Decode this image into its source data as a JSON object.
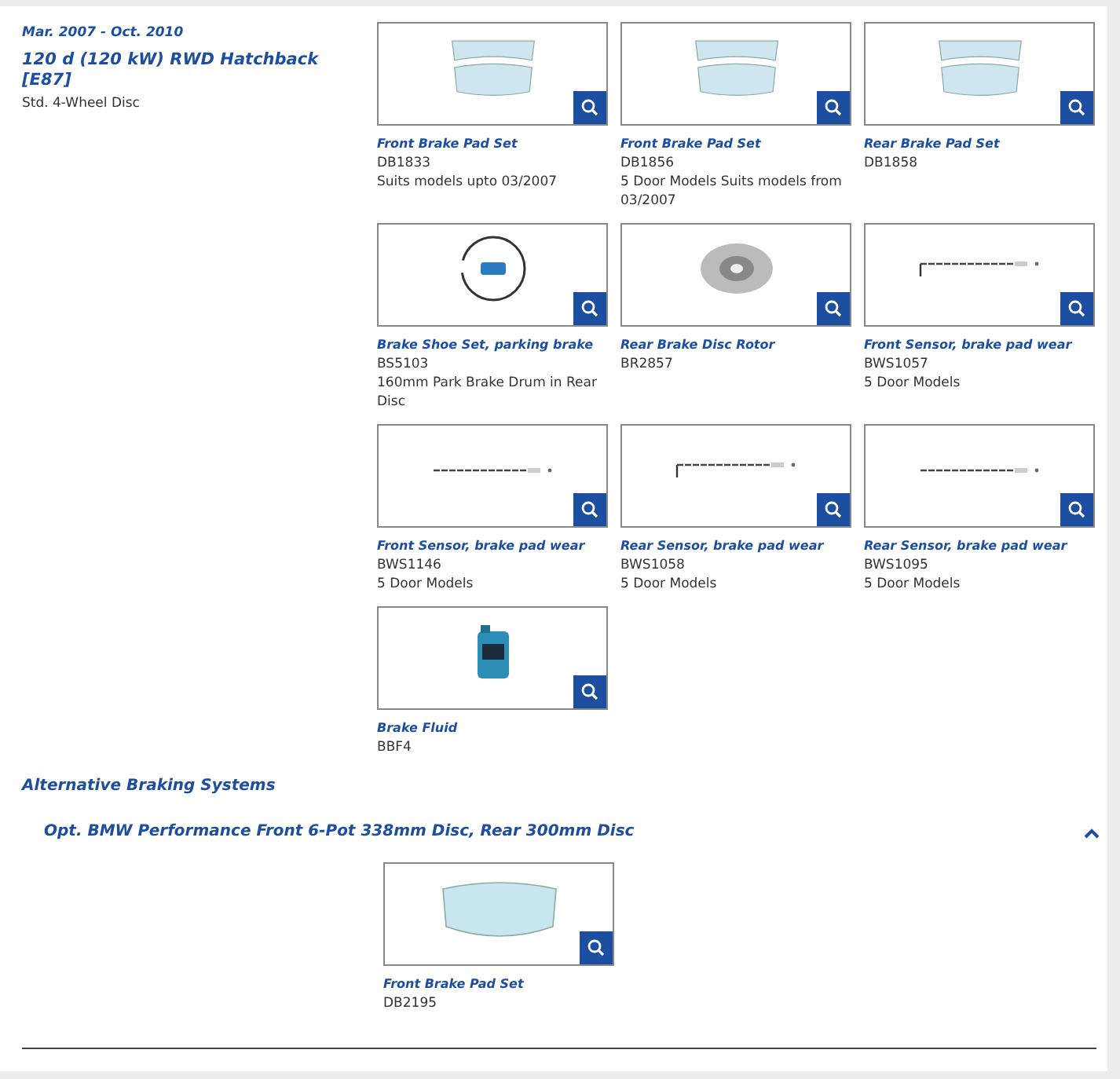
{
  "vehicle": {
    "date_range": "Mar. 2007 - Oct. 2010",
    "model": "120 d (120 kW) RWD Hatchback [E87]",
    "brake_type": "Std. 4-Wheel Disc"
  },
  "products": [
    {
      "kind": "pad",
      "title": "Front Brake Pad Set",
      "code": "DB1833",
      "note": "Suits models upto 03/2007"
    },
    {
      "kind": "pad",
      "title": "Front Brake Pad Set",
      "code": "DB1856",
      "note": "5 Door Models Suits models from 03/2007"
    },
    {
      "kind": "pad",
      "title": "Rear Brake Pad Set",
      "code": "DB1858"
    },
    {
      "kind": "shoe",
      "title": "Brake Shoe Set, parking brake",
      "code": "BS5103",
      "note": "160mm Park Brake Drum in Rear Disc"
    },
    {
      "kind": "disc",
      "title": "Rear Brake Disc Rotor",
      "code": "BR2857"
    },
    {
      "kind": "sensor_bent",
      "title": "Front Sensor, brake pad wear",
      "code": "BWS1057",
      "note": "5 Door Models"
    },
    {
      "kind": "sensor",
      "title": "Front Sensor, brake pad wear",
      "code": "BWS1146",
      "note": "5 Door Models"
    },
    {
      "kind": "sensor_bent",
      "title": "Rear Sensor, brake pad wear",
      "code": "BWS1058",
      "note": "5 Door Models"
    },
    {
      "kind": "sensor",
      "title": "Rear Sensor, brake pad wear",
      "code": "BWS1095",
      "note": "5 Door Models"
    },
    {
      "kind": "fluid",
      "title": "Brake Fluid",
      "code": "BBF4"
    }
  ],
  "alternative": {
    "heading": "Alternative Braking Systems",
    "groups": [
      {
        "title": "Opt. BMW Performance Front 6-Pot 338mm Disc, Rear 300mm Disc",
        "expanded": true,
        "products": [
          {
            "kind": "single_pad",
            "title": "Front Brake Pad Set",
            "code": "DB2195"
          }
        ]
      }
    ]
  }
}
